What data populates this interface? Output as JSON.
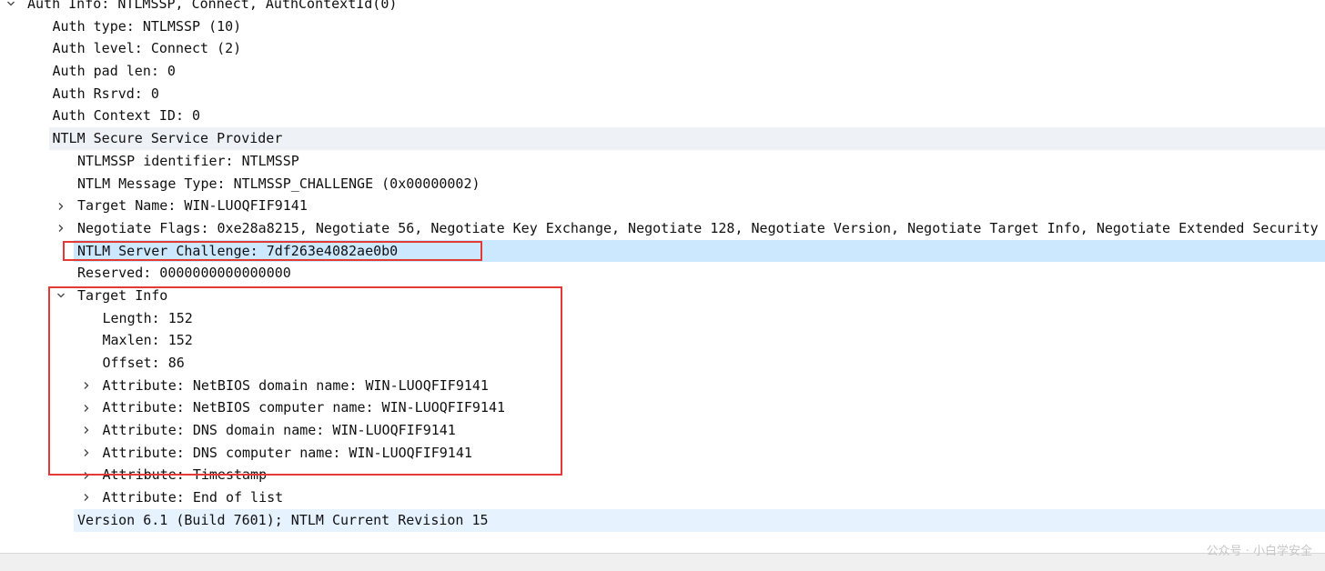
{
  "packet_details": {
    "rows": [
      {
        "indent": 0,
        "toggle": "expanded",
        "text": "Auth Info: NTLMSSP, Connect, AuthContextId(0)"
      },
      {
        "indent": 1,
        "toggle": "none",
        "text": "Auth type: NTLMSSP (10)"
      },
      {
        "indent": 1,
        "toggle": "none",
        "text": "Auth level: Connect (2)"
      },
      {
        "indent": 1,
        "toggle": "none",
        "text": "Auth pad len: 0"
      },
      {
        "indent": 1,
        "toggle": "none",
        "text": "Auth Rsrvd: 0"
      },
      {
        "indent": 1,
        "toggle": "none",
        "text": "Auth Context ID: 0"
      },
      {
        "indent": 1,
        "toggle": "expanded",
        "text": "NTLM Secure Service Provider",
        "highlight": "grey"
      },
      {
        "indent": 2,
        "toggle": "none",
        "text": "NTLMSSP identifier: NTLMSSP"
      },
      {
        "indent": 2,
        "toggle": "none",
        "text": "NTLM Message Type: NTLMSSP_CHALLENGE (0x00000002)"
      },
      {
        "indent": 2,
        "toggle": "collapsed",
        "text": "Target Name: WIN-LUOQFIF9141"
      },
      {
        "indent": 2,
        "toggle": "collapsed",
        "text": "Negotiate Flags: 0xe28a8215, Negotiate 56, Negotiate Key Exchange, Negotiate 128, Negotiate Version, Negotiate Target Info, Negotiate Extended Security"
      },
      {
        "indent": 2,
        "toggle": "none",
        "text": "NTLM Server Challenge: 7df263e4082ae0b0",
        "highlight": "selected"
      },
      {
        "indent": 2,
        "toggle": "none",
        "text": "Reserved: 0000000000000000"
      },
      {
        "indent": 2,
        "toggle": "expanded",
        "text": "Target Info"
      },
      {
        "indent": 3,
        "toggle": "none",
        "text": "Length: 152"
      },
      {
        "indent": 3,
        "toggle": "none",
        "text": "Maxlen: 152"
      },
      {
        "indent": 3,
        "toggle": "none",
        "text": "Offset: 86"
      },
      {
        "indent": 3,
        "toggle": "collapsed",
        "text": "Attribute: NetBIOS domain name: WIN-LUOQFIF9141"
      },
      {
        "indent": 3,
        "toggle": "collapsed",
        "text": "Attribute: NetBIOS computer name: WIN-LUOQFIF9141"
      },
      {
        "indent": 3,
        "toggle": "collapsed",
        "text": "Attribute: DNS domain name: WIN-LUOQFIF9141"
      },
      {
        "indent": 3,
        "toggle": "collapsed",
        "text": "Attribute: DNS computer name: WIN-LUOQFIF9141"
      },
      {
        "indent": 3,
        "toggle": "collapsed",
        "text": "Attribute: Timestamp"
      },
      {
        "indent": 3,
        "toggle": "collapsed",
        "text": "Attribute: End of list"
      },
      {
        "indent": 2,
        "toggle": "collapsed",
        "text": "Version 6.1 (Build 7601); NTLM Current Revision 15",
        "highlight": "light"
      }
    ]
  },
  "watermark": "公众号 · 小白学安全",
  "colors": {
    "selected_row": "#cce8ff",
    "grey_row": "#eef1f6",
    "light_row": "#e6f3ff",
    "annotation_box": "#e53935"
  }
}
